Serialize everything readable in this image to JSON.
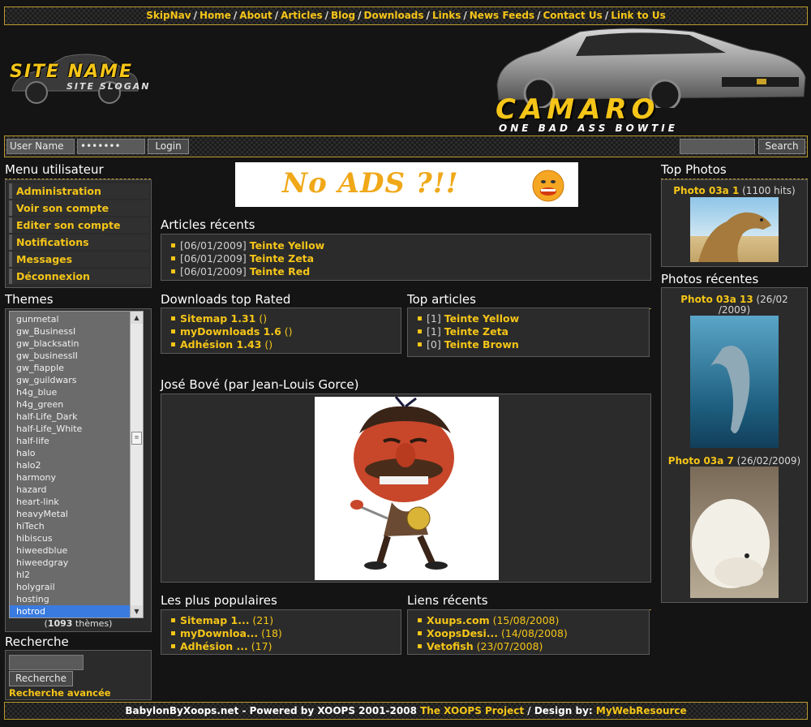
{
  "nav": {
    "items": [
      "SkipNav",
      "Home",
      "About",
      "Articles",
      "Blog",
      "Downloads",
      "Links",
      "News Feeds",
      "Contact Us",
      "Link to Us"
    ],
    "separator": "/"
  },
  "header": {
    "site_name": "SITE NAME",
    "site_slogan": "SITE SLOGAN",
    "banner_title": "CAMARO",
    "banner_tagline": "ONE BAD ASS BOWTIE"
  },
  "login": {
    "username_placeholder": "User Name",
    "password_value": "•••••••",
    "login_label": "Login",
    "search_label": "Search"
  },
  "user_menu": {
    "title": "Menu utilisateur",
    "items": [
      "Administration",
      "Voir son compte",
      "Editer son compte",
      "Notifications",
      "Messages",
      "Déconnexion"
    ]
  },
  "themes": {
    "title": "Themes",
    "options": [
      "gunmetal",
      "gw_BusinessI",
      "gw_blacksatin",
      "gw_businessII",
      "gw_fiapple",
      "gw_guildwars",
      "h4g_blue",
      "h4g_green",
      "half-Life_Dark",
      "half-Life_White",
      "half-life",
      "halo",
      "halo2",
      "harmony",
      "hazard",
      "heart-link",
      "heavyMetal",
      "hiTech",
      "hibiscus",
      "hiweedblue",
      "hiweedgray",
      "hl2",
      "holygrail",
      "hosting",
      "hotrod"
    ],
    "selected": "hotrod",
    "count": "1093",
    "count_suffix": " thèmes)",
    "count_prefix": "("
  },
  "search_block": {
    "title": "Recherche",
    "button_label": "Recherche",
    "advanced_label": "Recherche avancée"
  },
  "ad": {
    "text": "No ADS ?!!"
  },
  "recent_articles": {
    "title": "Articles récents",
    "items": [
      {
        "date": "[06/01/2009]",
        "title": "Teinte Yellow"
      },
      {
        "date": "[06/01/2009]",
        "title": "Teinte Zeta"
      },
      {
        "date": "[06/01/2009]",
        "title": "Teinte Red"
      }
    ]
  },
  "downloads_top": {
    "title": "Downloads top Rated",
    "items": [
      {
        "name": "Sitemap 1.31",
        "extra": " ()"
      },
      {
        "name": "myDownloads 1.6",
        "extra": " ()"
      },
      {
        "name": "Adhésion 1.43",
        "extra": " ()"
      }
    ]
  },
  "top_articles": {
    "title": "Top articles",
    "items": [
      {
        "count": "[1]",
        "title": "Teinte Yellow"
      },
      {
        "count": "[1]",
        "title": "Teinte Zeta"
      },
      {
        "count": "[0]",
        "title": "Teinte Brown"
      }
    ]
  },
  "cartoon": {
    "title": "José Bové (par Jean-Louis Gorce)"
  },
  "popular": {
    "title": "Les plus populaires",
    "items": [
      {
        "name": "Sitemap 1...",
        "extra": " (21)"
      },
      {
        "name": "myDownloa...",
        "extra": " (18)"
      },
      {
        "name": "Adhésion ...",
        "extra": " (17)"
      }
    ]
  },
  "recent_links": {
    "title": "Liens récents",
    "items": [
      {
        "name": "Xuups.com",
        "extra": " (15/08/2008)"
      },
      {
        "name": "XoopsDesi...",
        "extra": " (14/08/2008)"
      },
      {
        "name": "Vetofish",
        "extra": " (23/07/2008)"
      }
    ]
  },
  "top_photos": {
    "title": "Top Photos",
    "photo_name": "Photo 03a 1",
    "photo_extra": " (1100 hits)"
  },
  "recent_photos": {
    "title": "Photos récentes",
    "p1_name": "Photo 03a 13",
    "p1_extra_a": " (26/02",
    "p1_extra_b": "/2009)",
    "p2_name": "Photo 03a 7",
    "p2_extra": " (26/02/2009)"
  },
  "footer": {
    "text": "BabylonByXoops.net - Powered by XOOPS 2001-2008 ",
    "xoops_link": "The XOOPS Project",
    "design_text": " / Design by: ",
    "design_link": "MyWebResource"
  },
  "colors": {
    "accent": "#f5c518",
    "background": "#141414",
    "panel": "#2b2b2b",
    "selection": "#3a7be0"
  }
}
